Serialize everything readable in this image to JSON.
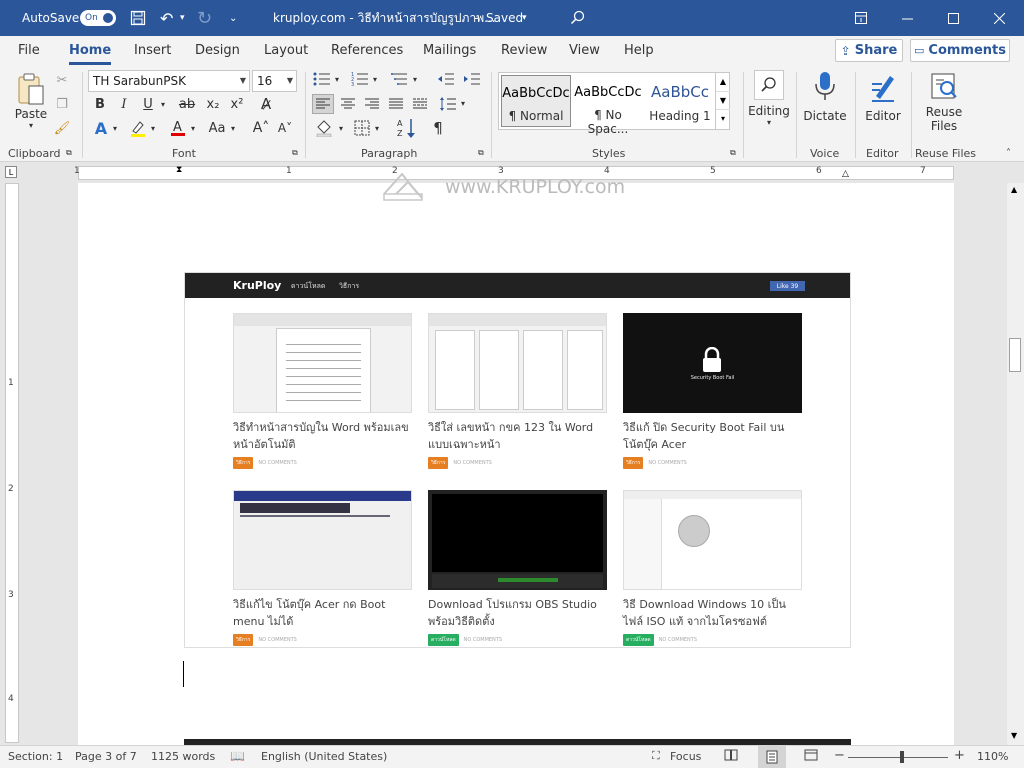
{
  "titlebar": {
    "autosave_label": "AutoSave",
    "autosave_state": "On",
    "doc_title": "kruploy.com - วิธีทำหน้าสารบัญรูปภาพ...",
    "saved": "Saved"
  },
  "menu": {
    "tabs": [
      "File",
      "Home",
      "Insert",
      "Design",
      "Layout",
      "References",
      "Mailings",
      "Review",
      "View",
      "Help"
    ],
    "share": "Share",
    "comments": "Comments"
  },
  "ribbon": {
    "clipboard": {
      "paste": "Paste",
      "label": "Clipboard"
    },
    "font": {
      "family": "TH SarabunPSK",
      "size": "16",
      "label": "Font"
    },
    "paragraph": {
      "label": "Paragraph"
    },
    "styles": {
      "label": "Styles",
      "items": [
        {
          "sample": "AaBbCcDc",
          "name": "¶ Normal"
        },
        {
          "sample": "AaBbCcDc",
          "name": "¶ No Spac..."
        },
        {
          "sample": "AaBbCc",
          "name": "Heading 1"
        }
      ]
    },
    "editing": {
      "label": "Editing"
    },
    "voice": {
      "dictate": "Dictate",
      "label": "Voice"
    },
    "editor": {
      "button": "Editor",
      "label": "Editor"
    },
    "reuse": {
      "button_line1": "Reuse",
      "button_line2": "Files",
      "label": "Reuse Files"
    }
  },
  "ruler": {
    "top_numbers": [
      "1",
      "1",
      "2",
      "3",
      "4",
      "5",
      "6",
      "7"
    ],
    "left_numbers": [
      "1",
      "2",
      "3",
      "4"
    ]
  },
  "watermark": "www.KRUPLOY.com",
  "website": {
    "logo": "KruPloy",
    "nav": [
      "ดาวน์โหลด",
      "วิธีการ"
    ],
    "like": "Like 39",
    "posts": [
      {
        "title": "วิธีทำหน้าสารบัญใน Word พร้อมเลขหน้าอัตโนมัติ",
        "category": "วิธีการ",
        "comments": "NO COMMENTS"
      },
      {
        "title": "วิธีใส่ เลขหน้า กขค 123 ใน Word แบบเฉพาะหน้า",
        "category": "วิธีการ",
        "comments": "NO COMMENTS"
      },
      {
        "title": "วิธีแก้ ปิด Security Boot Fail บนโน้ตบุ๊ค Acer",
        "category": "วิธีการ",
        "comments": "NO COMMENTS",
        "thumb_text": "Security Boot Fail"
      },
      {
        "title": "วิธีแก้ไข โน้ตบุ๊ค Acer กด Boot menu ไม่ได้",
        "category": "วิธีการ",
        "comments": "NO COMMENTS"
      },
      {
        "title": "Download โปรแกรม OBS Studio พร้อมวิธีติดตั้ง",
        "category": "ดาวน์โหลด",
        "comments": "NO COMMENTS"
      },
      {
        "title": "วิธี Download Windows 10 เป็นไฟล์ ISO แท้ จากไมโครซอฟต์",
        "category": "ดาวน์โหลด",
        "comments": "NO COMMENTS"
      }
    ]
  },
  "status": {
    "section": "Section: 1",
    "page": "Page 3 of 7",
    "words": "1125 words",
    "language": "English (United States)",
    "focus": "Focus",
    "zoom": "110%"
  },
  "colors": {
    "word_blue": "#2b579a",
    "cat_orange": "#e67e22",
    "cat_green": "#27ae60"
  }
}
